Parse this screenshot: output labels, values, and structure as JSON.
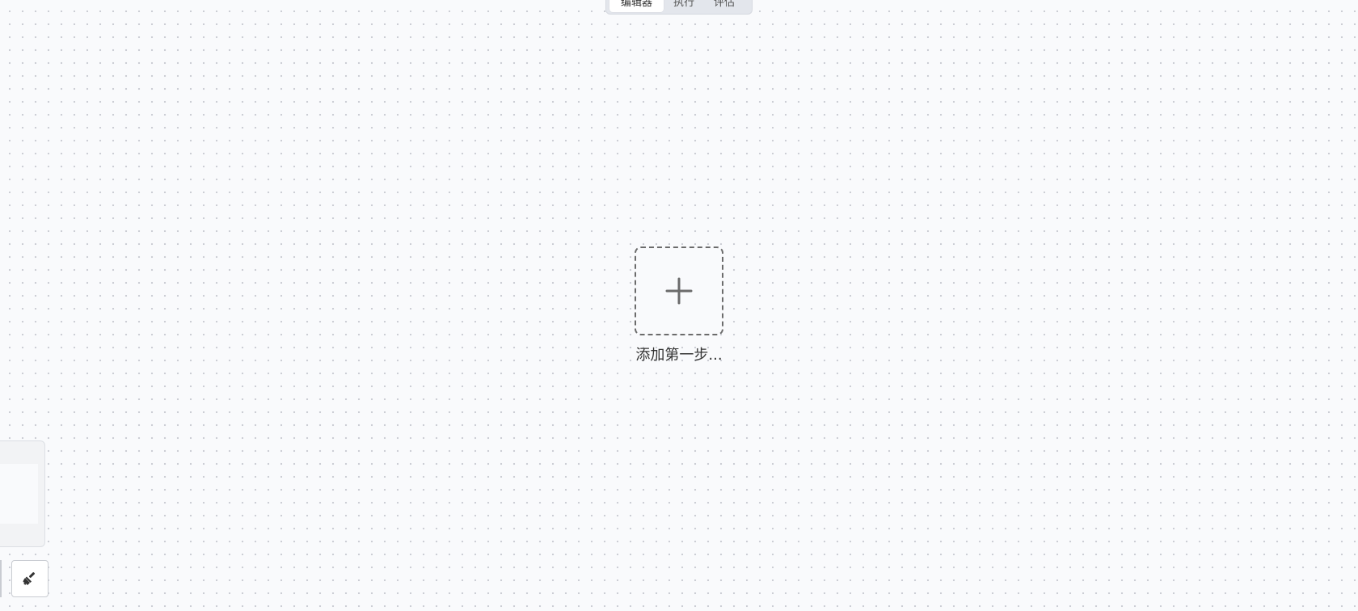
{
  "mode_tabs": [
    {
      "label": "编辑器",
      "active": true
    },
    {
      "label": "执行",
      "active": false
    },
    {
      "label": "评估",
      "active": false
    }
  ],
  "canvas": {
    "add_step_label": "添加第一步...",
    "add_step_icon": "plus-icon"
  },
  "toolbar": {
    "clear_icon": "broom-icon"
  },
  "colors": {
    "background": "#f9fafc",
    "dot_grid": "#c9ccd3",
    "dashed_border": "#6b6b6b",
    "tab_bar": "#e3e6ec"
  }
}
